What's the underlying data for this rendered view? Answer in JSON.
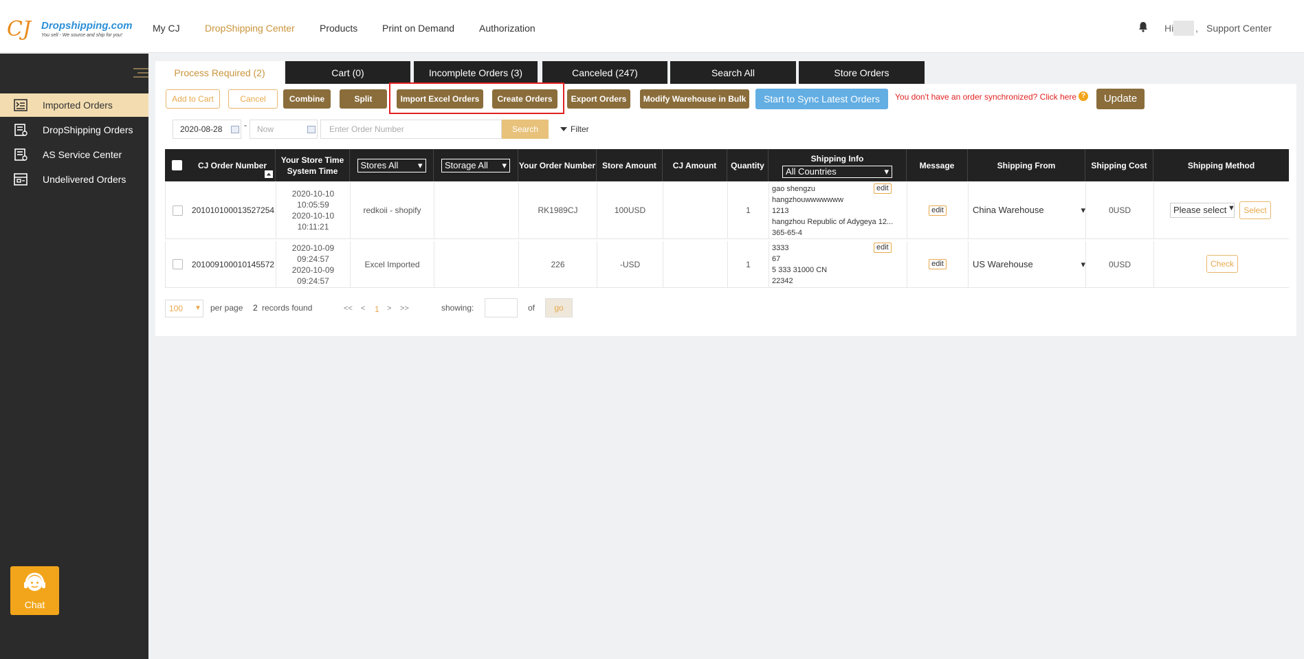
{
  "header": {
    "logo": {
      "mark": "CJ",
      "name": "Dropshipping.com",
      "tagline": "You sell - We source and ship for you!"
    },
    "nav": [
      "My CJ",
      "DropShipping Center",
      "Products",
      "Print on Demand",
      "Authorization"
    ],
    "active_nav": "DropShipping Center",
    "greeting": "Hi",
    "greeting_comma": ",",
    "support": "Support Center"
  },
  "sidebar": {
    "items": [
      {
        "label": "Imported Orders",
        "icon": "import-list-icon",
        "active": true
      },
      {
        "label": "DropShipping Orders",
        "icon": "orders-icon",
        "active": false
      },
      {
        "label": "AS Service Center",
        "icon": "service-icon",
        "active": false
      },
      {
        "label": "Undelivered Orders",
        "icon": "undelivered-icon",
        "active": false
      }
    ],
    "chat_label": "Chat"
  },
  "tabs": [
    "Process Required (2)",
    "Cart (0)",
    "Incomplete Orders (3)",
    "Canceled (247)",
    "Search All",
    "Store Orders"
  ],
  "toolbar": {
    "add_to_cart": "Add to Cart",
    "cancel": "Cancel",
    "combine": "Combine",
    "split": "Split",
    "import_excel": "Import Excel Orders",
    "create_orders": "Create Orders",
    "export_orders": "Export Orders",
    "modify_warehouse": "Modify Warehouse in Bulk",
    "sync": "Start to Sync Latest Orders",
    "sync_message": "You don't have an order synchronized? Click here",
    "help": "?",
    "update": "Update"
  },
  "filters": {
    "date_from": "2020-08-28",
    "date_sep": "-",
    "date_to_placeholder": "Now",
    "order_placeholder": "Enter Order Number",
    "search": "Search",
    "filter": "Filter"
  },
  "table": {
    "headers": {
      "cj_order": "CJ Order Number",
      "store_time_1": "Your Store Time",
      "store_time_2": "System Time",
      "stores": "Stores All",
      "storage": "Storage All",
      "your_order": "Your Order Number",
      "store_amount": "Store Amount",
      "cj_amount": "CJ Amount",
      "quantity": "Quantity",
      "shipping_info": "Shipping Info",
      "countries": "All Countries",
      "message": "Message",
      "shipping_from": "Shipping From",
      "shipping_cost": "Shipping Cost",
      "shipping_method": "Shipping Method"
    },
    "rows": [
      {
        "cj_order": "201010100013527254",
        "time_store_date": "2020-10-10",
        "time_store_clock": "10:05:59",
        "time_system_date": "2020-10-10",
        "time_system_clock": "10:11:21",
        "store": "redkoii - shopify",
        "your_order": "RK1989CJ",
        "store_amount": "100USD",
        "quantity": "1",
        "ship_1": "gao shengzu",
        "ship_2": "hangzhouwwwwwww",
        "ship_3": "1213",
        "ship_4": "hangzhou Republic of Adygeya 12...",
        "ship_5": "365-65-4",
        "ship_edit": "edit",
        "message_edit": "edit",
        "warehouse": "China Warehouse",
        "shipping_cost": "0USD",
        "method_select": "Please select",
        "method_button": "Select"
      },
      {
        "cj_order": "201009100010145572",
        "time_store_date": "2020-10-09",
        "time_store_clock": "09:24:57",
        "time_system_date": "2020-10-09",
        "time_system_clock": "09:24:57",
        "store": "Excel Imported",
        "your_order": "226",
        "store_amount": "-USD",
        "quantity": "1",
        "ship_1": "3333",
        "ship_2": "67",
        "ship_3": "5 333 31000 CN",
        "ship_4": "22342",
        "ship_edit": "edit",
        "message_edit": "edit",
        "warehouse": "US Warehouse",
        "shipping_cost": "0USD",
        "method_button": "Check"
      }
    ]
  },
  "pagination": {
    "page_size": "100",
    "per_page": "per page",
    "records_count": "2",
    "records_found": "records found",
    "first": "<<",
    "prev": "<",
    "current": "1",
    "next": ">",
    "last": ">>",
    "showing": "showing:",
    "of": "of",
    "go": "go"
  },
  "colors": {
    "accent": "#c9943b",
    "brown_button": "#8a6d3b",
    "sidebar": "#2b2b2b",
    "highlight": "#e12121",
    "blue_button": "#63aee3"
  }
}
